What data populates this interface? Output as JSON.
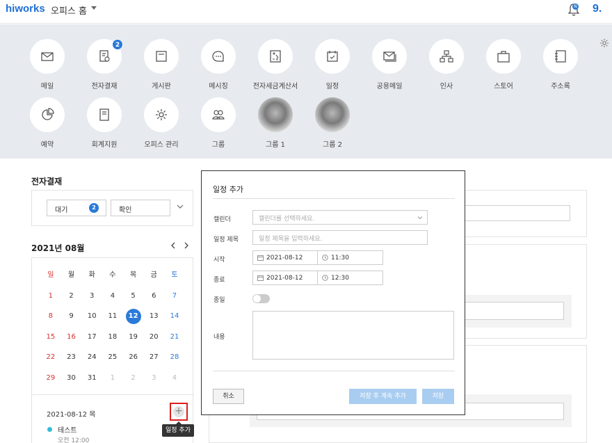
{
  "header": {
    "logo": "hiworks",
    "office_title": "오피스 홈",
    "notification_badge": "N",
    "user_logo": "9."
  },
  "apps": [
    {
      "label": "메일",
      "icon": "mail-icon"
    },
    {
      "label": "전자결재",
      "icon": "approval-icon",
      "badge": "2"
    },
    {
      "label": "게시판",
      "icon": "board-icon"
    },
    {
      "label": "메시징",
      "icon": "message-icon"
    },
    {
      "label": "전자세금계산서",
      "icon": "tax-invoice-icon"
    },
    {
      "label": "일정",
      "icon": "calendar-icon"
    },
    {
      "label": "공용메일",
      "icon": "shared-mail-icon"
    },
    {
      "label": "인사",
      "icon": "org-chart-icon"
    },
    {
      "label": "스토어",
      "icon": "store-icon"
    },
    {
      "label": "주소록",
      "icon": "address-book-icon"
    },
    {
      "label": "예약",
      "icon": "reservation-icon"
    },
    {
      "label": "회계지원",
      "icon": "accounting-icon"
    },
    {
      "label": "오피스 관리",
      "icon": "settings-icon"
    },
    {
      "label": "그룹",
      "icon": "group-icon"
    },
    {
      "label": "그룹 1",
      "icon": "group-photo"
    },
    {
      "label": "그룹 2",
      "icon": "group-photo"
    }
  ],
  "approval": {
    "title": "전자결재",
    "wait_label": "대기",
    "wait_count": "2",
    "confirm_label": "확인"
  },
  "calendar": {
    "month_title": "2021년 08월",
    "weekdays": [
      "일",
      "월",
      "화",
      "수",
      "목",
      "금",
      "토"
    ],
    "weeks": [
      [
        "1",
        "2",
        "3",
        "4",
        "5",
        "6",
        "7"
      ],
      [
        "8",
        "9",
        "10",
        "11",
        "12",
        "13",
        "14"
      ],
      [
        "15",
        "16",
        "17",
        "18",
        "19",
        "20",
        "21"
      ],
      [
        "22",
        "23",
        "24",
        "25",
        "26",
        "27",
        "28"
      ],
      [
        "29",
        "30",
        "31",
        "1",
        "2",
        "3",
        "4"
      ]
    ],
    "today": "12",
    "holiday_red": [
      "16"
    ],
    "selected_date": "2021-08-12 목",
    "add_tooltip": "일정 추가",
    "event": {
      "title": "테스트",
      "time": "오전 12:00"
    }
  },
  "modal": {
    "title": "일정 추가",
    "calendar_label": "캘린더",
    "calendar_placeholder": "캘린더를 선택하세요.",
    "subject_label": "일정 제목",
    "subject_placeholder": "일정 제목을 입력하세요.",
    "start_label": "시작",
    "start_date": "2021-08-12",
    "start_time": "11:30",
    "end_label": "종료",
    "end_date": "2021-08-12",
    "end_time": "12:30",
    "allday_label": "종일",
    "allday_on": false,
    "content_label": "내용",
    "cancel_label": "취소",
    "save_continue_label": "저장 후 계속 추가",
    "save_label": "저장"
  },
  "colors": {
    "brand": "#1f6fd6",
    "accent": "#2a7ad8",
    "sunday": "#d9302c",
    "saturday": "#2a7ad8",
    "disabled_button": "#a9cdf0"
  }
}
